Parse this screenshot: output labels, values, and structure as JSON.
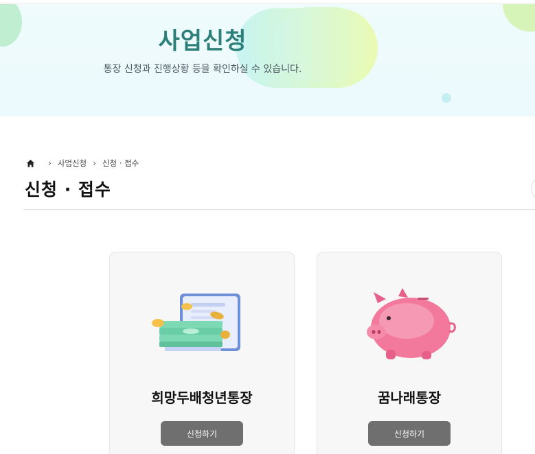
{
  "hero": {
    "title": "사업신청",
    "subtitle": "통장 신청과 진행상황 등을 확인하실 수 있습니다."
  },
  "breadcrumb": {
    "home_icon": "home-icon",
    "items": [
      "사업신청",
      "신청 · 접수"
    ]
  },
  "page": {
    "title": "신청 · 접수"
  },
  "cards": [
    {
      "name": "희망두배청년통장",
      "icon": "money-wallet-icon",
      "button_label": "신청하기"
    },
    {
      "name": "꿈나래통장",
      "icon": "piggy-bank-icon",
      "button_label": "신청하기"
    }
  ],
  "colors": {
    "hero_title": "#2d7f7a",
    "hero_bg": "#effbfc",
    "button_bg": "#6f6f6f",
    "card_bg": "#f7f7f7"
  }
}
